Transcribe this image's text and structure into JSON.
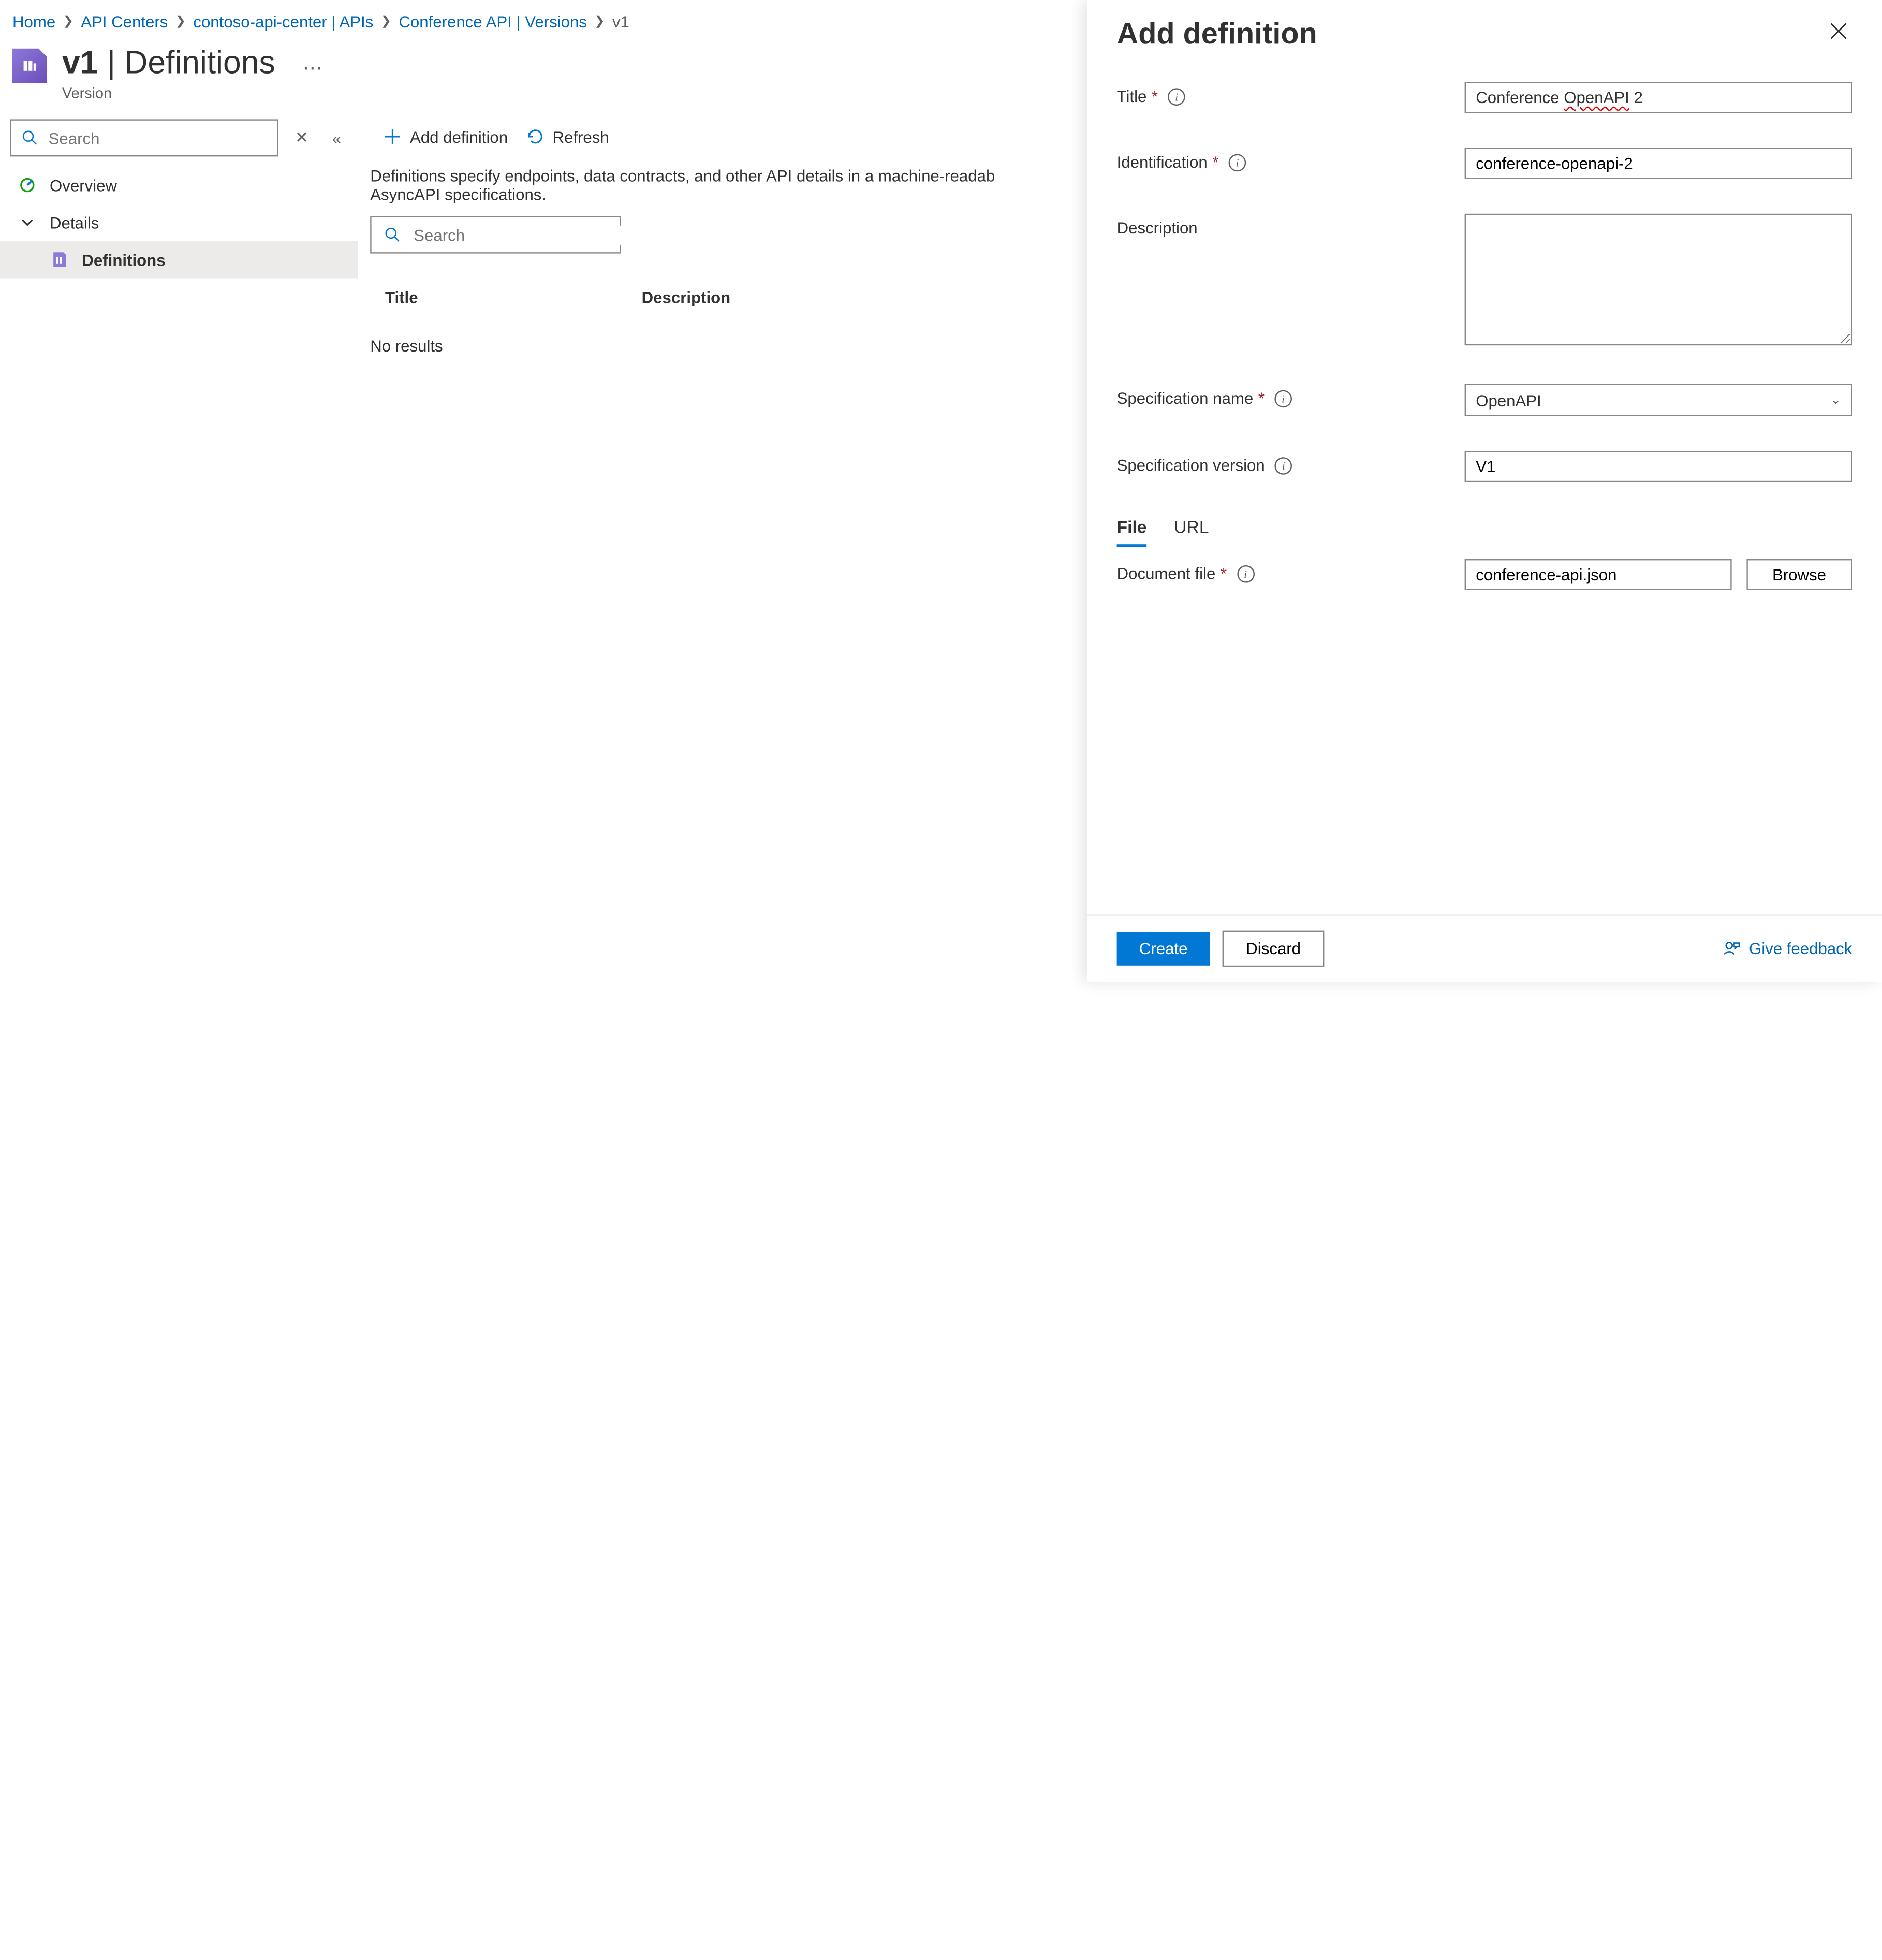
{
  "breadcrumb": [
    {
      "label": "Home",
      "link": true
    },
    {
      "label": "API Centers",
      "link": true
    },
    {
      "label": "contoso-api-center | APIs",
      "link": true
    },
    {
      "label": "Conference API | Versions",
      "link": true
    },
    {
      "label": "v1",
      "link": false
    }
  ],
  "page_title_prefix": "v1",
  "page_title_suffix": "Definitions",
  "page_subtitle": "Version",
  "sidebar": {
    "search_placeholder": "Search",
    "items": [
      {
        "label": "Overview",
        "icon": "overview",
        "child": false,
        "selected": false
      },
      {
        "label": "Details",
        "icon": "chevron",
        "child": false,
        "selected": false
      },
      {
        "label": "Definitions",
        "icon": "definition",
        "child": true,
        "selected": true
      }
    ]
  },
  "toolbar": {
    "add_label": "Add definition",
    "refresh_label": "Refresh"
  },
  "main": {
    "description": "Definitions specify endpoints, data contracts, and other API details in a machine-readab",
    "description_suffix": "AsyncAPI specifications.",
    "search_placeholder": "Search",
    "columns": [
      "Title",
      "Description"
    ],
    "no_results": "No results"
  },
  "panel": {
    "title": "Add definition",
    "fields": {
      "title": {
        "label": "Title",
        "value_pre": "Conference ",
        "value_mark": "OpenAPI",
        "value_post": " 2"
      },
      "identification": {
        "label": "Identification",
        "value": "conference-openapi-2"
      },
      "description": {
        "label": "Description",
        "value": ""
      },
      "spec_name": {
        "label": "Specification name",
        "value": "OpenAPI"
      },
      "spec_version": {
        "label": "Specification version",
        "value": "V1"
      },
      "doc_file": {
        "label": "Document file",
        "value": "conference-api.json"
      }
    },
    "tabs": [
      "File",
      "URL"
    ],
    "browse_label": "Browse",
    "create_label": "Create",
    "discard_label": "Discard",
    "feedback_label": "Give feedback"
  }
}
